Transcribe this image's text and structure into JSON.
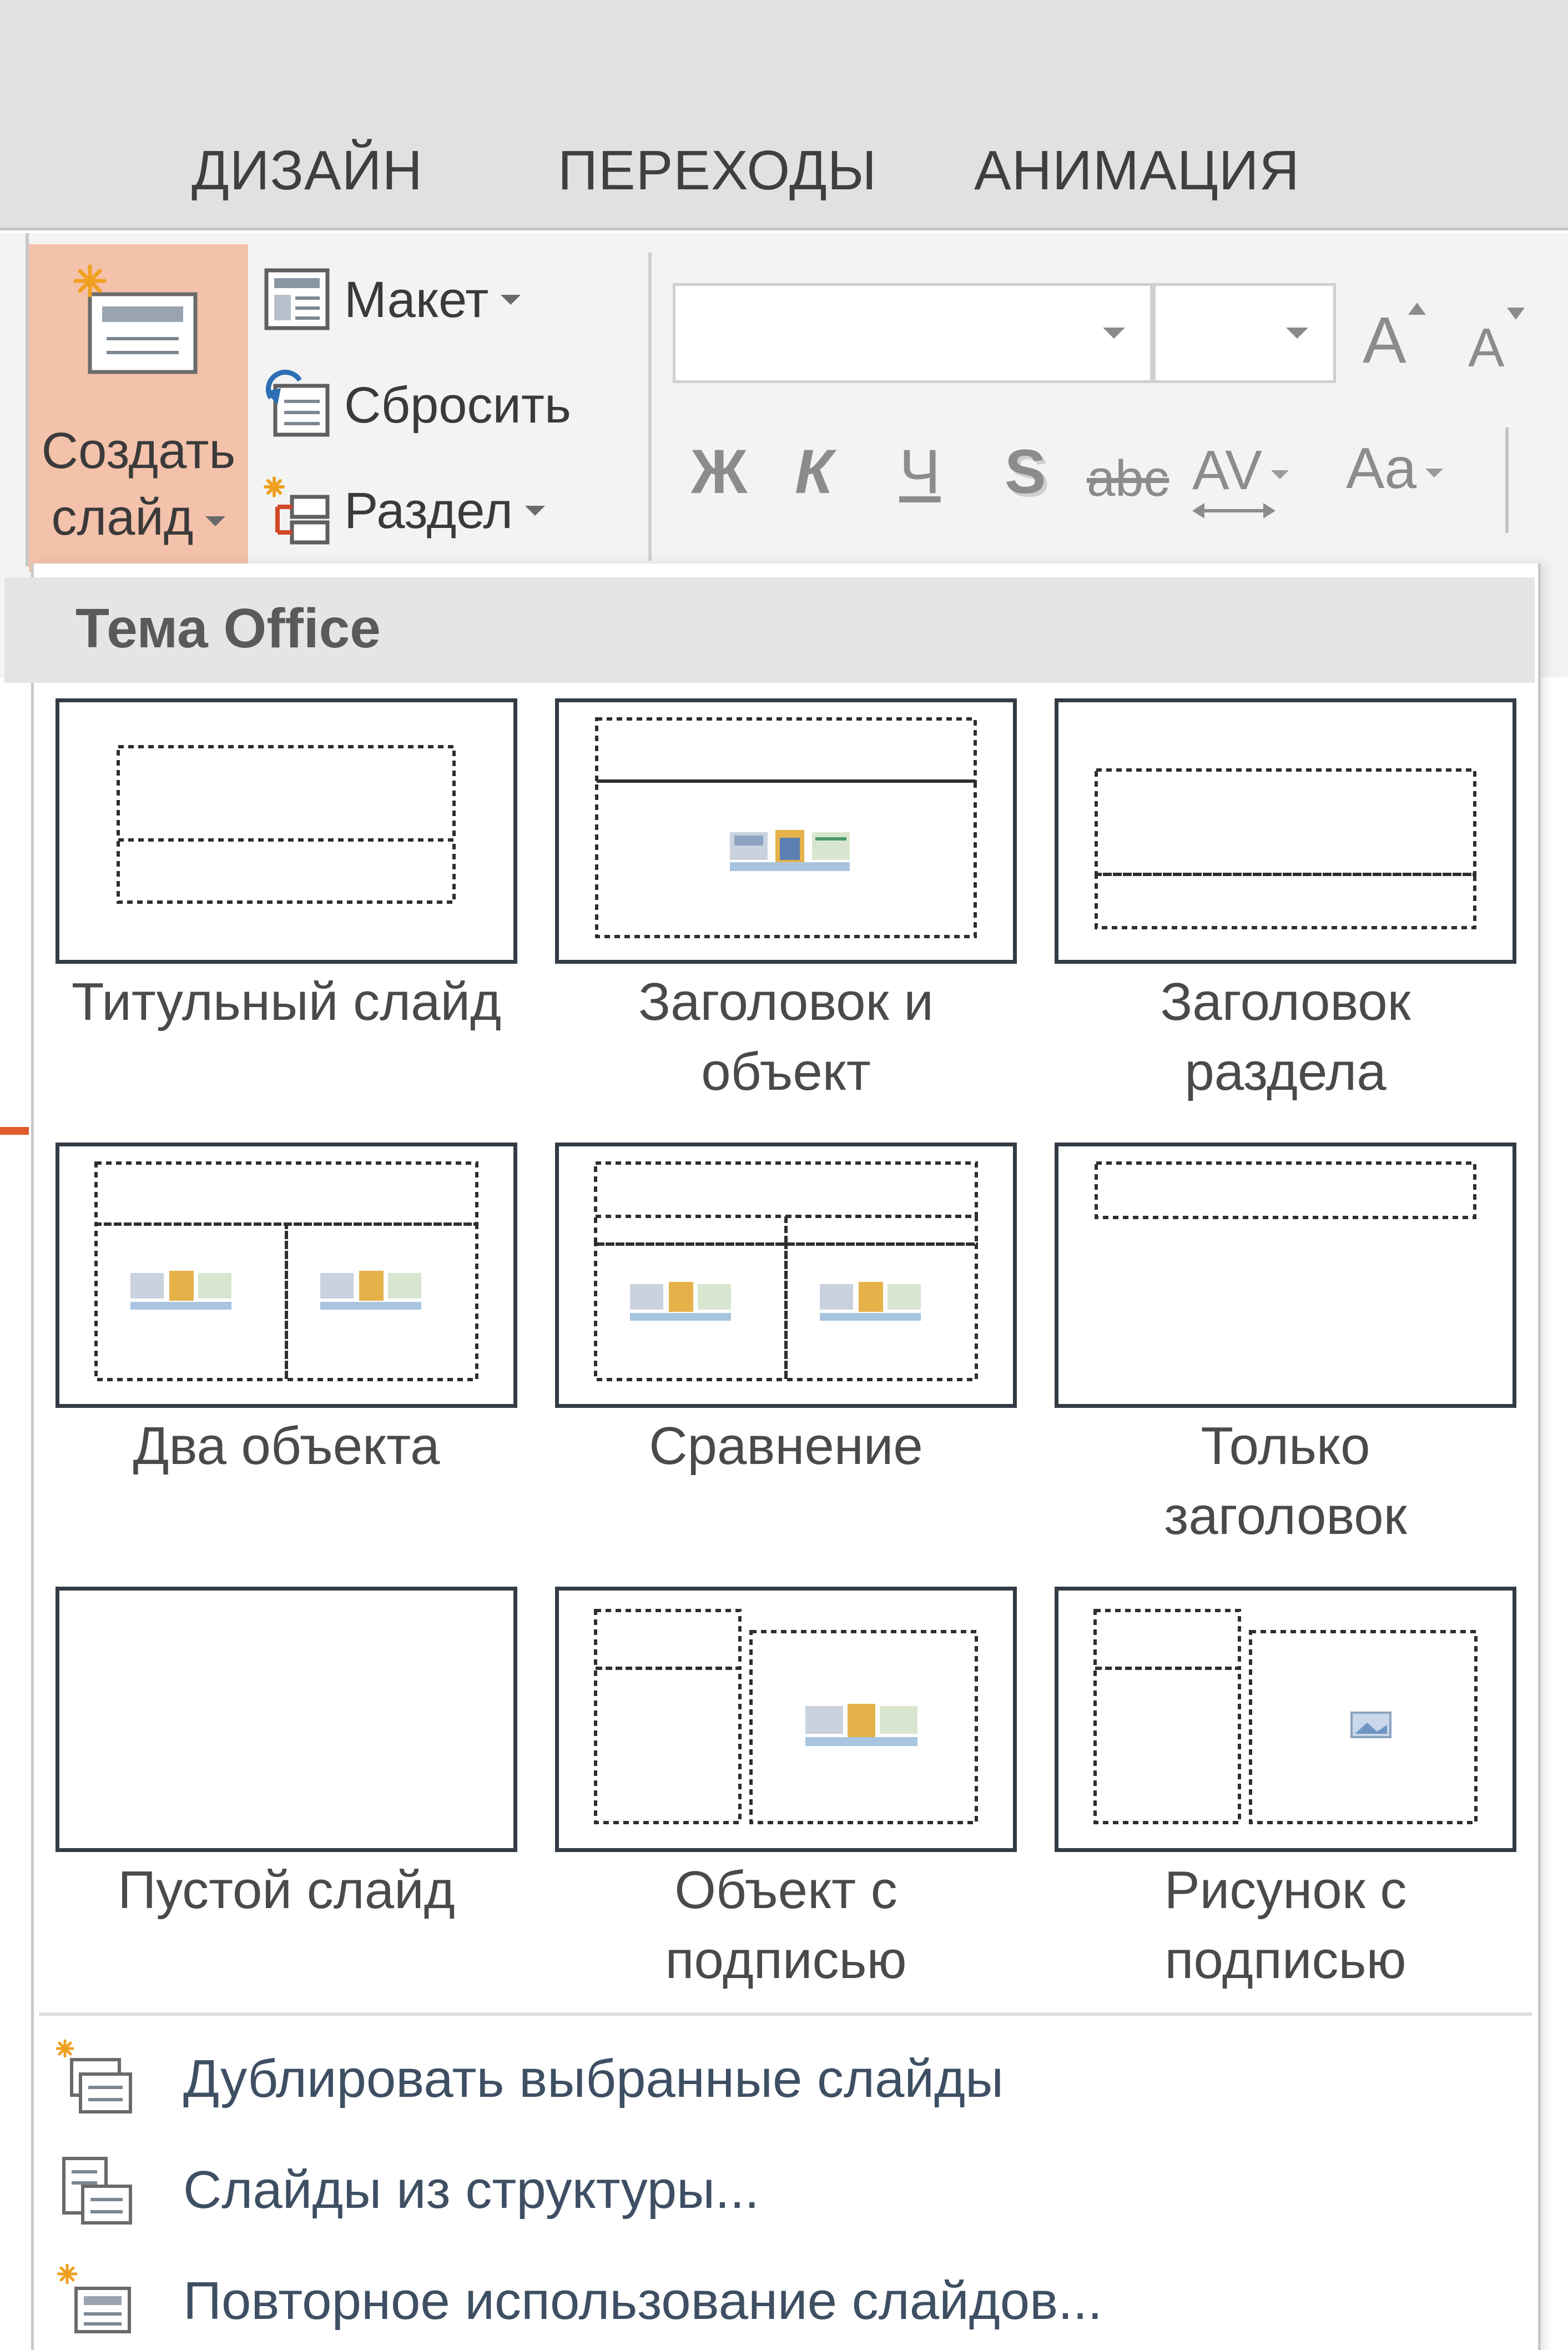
{
  "tabs": [
    "ДИЗАЙН",
    "ПЕРЕХОДЫ",
    "АНИМАЦИЯ"
  ],
  "ribbon": {
    "new_slide": {
      "line1": "Создать",
      "line2": "слайд"
    },
    "layout": "Макет",
    "reset": "Сбросить",
    "section": "Раздел",
    "font_name_value": "",
    "font_size_value": "",
    "grow_font": "A",
    "shrink_font": "A",
    "bold": "Ж",
    "italic": "К",
    "underline": "Ч",
    "shadow": "S",
    "strikethrough": "abc",
    "spacing": "AV",
    "change_case": "Aa"
  },
  "gallery": {
    "title": "Тема Office",
    "layouts": [
      {
        "line1": "Титульный слайд",
        "line2": ""
      },
      {
        "line1": "Заголовок и",
        "line2": "объект"
      },
      {
        "line1": "Заголовок",
        "line2": "раздела"
      },
      {
        "line1": "Два объекта",
        "line2": ""
      },
      {
        "line1": "Сравнение",
        "line2": ""
      },
      {
        "line1": "Только",
        "line2": "заголовок"
      },
      {
        "line1": "Пустой слайд",
        "line2": ""
      },
      {
        "line1": "Объект с",
        "line2": "подписью"
      },
      {
        "line1": "Рисунок с",
        "line2": "подписью"
      }
    ]
  },
  "menu": [
    {
      "label": "Дублировать выбранные слайды",
      "icon": "duplicate-slides-icon"
    },
    {
      "label": "Слайды из структуры...",
      "icon": "slides-from-outline-icon"
    },
    {
      "label": "Повторное использование слайдов...",
      "icon": "reuse-slides-icon"
    }
  ],
  "colors": {
    "active_button": "#f4c1aa",
    "accent_orange": "#e05a2b",
    "tile_border": "#333b45",
    "menu_text": "#3e4f63"
  }
}
